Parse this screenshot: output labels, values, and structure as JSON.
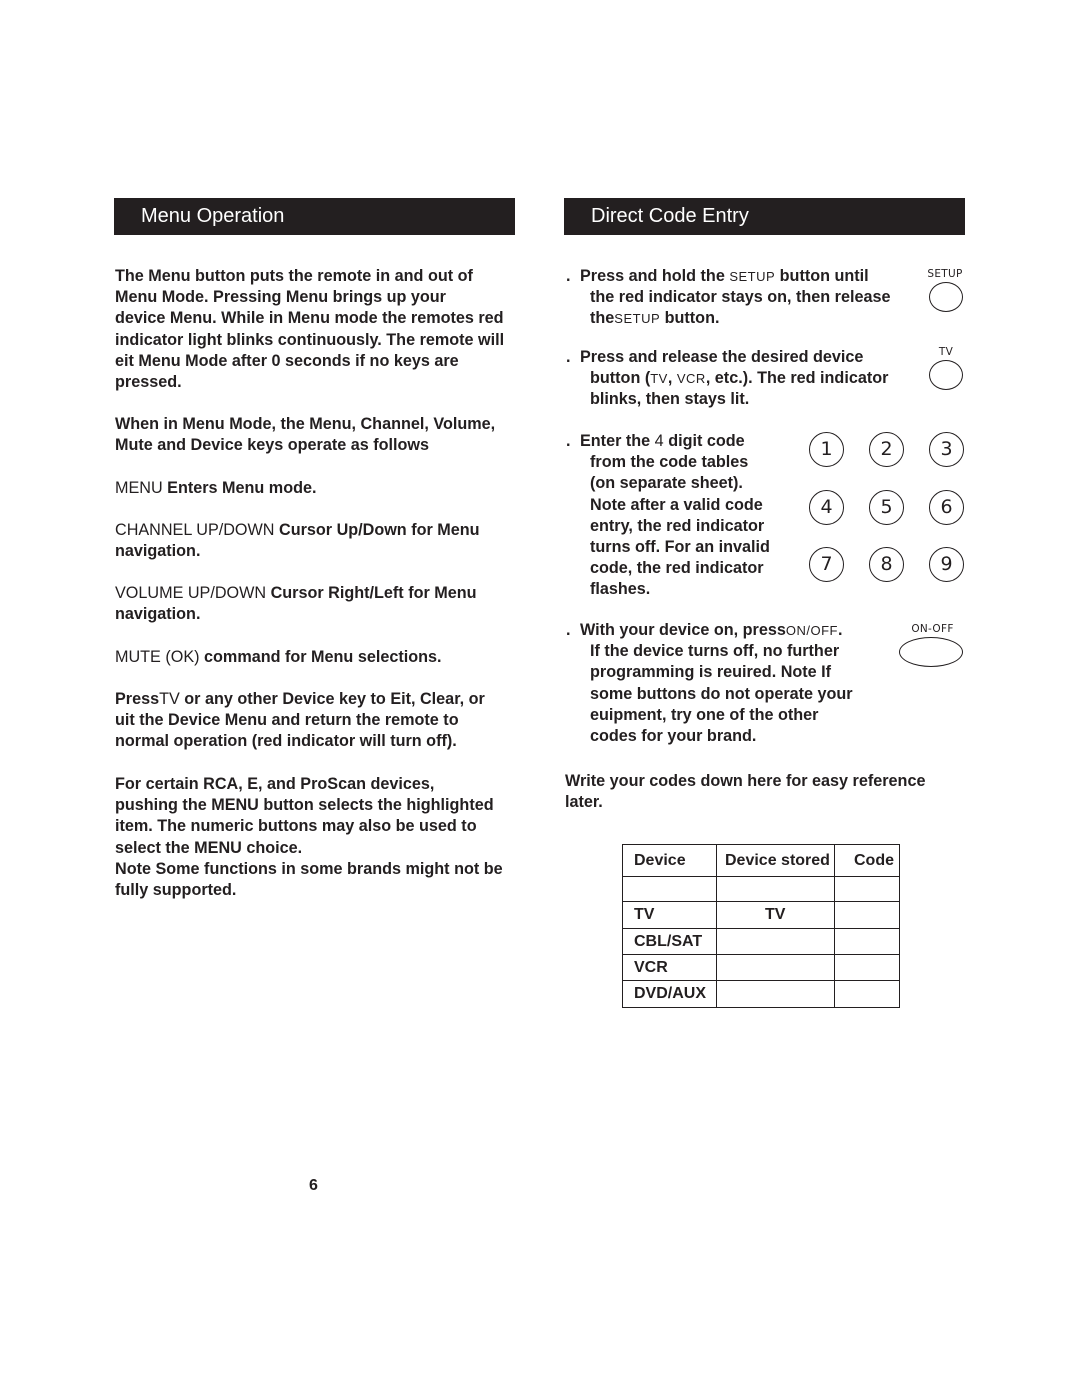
{
  "menu_operation": {
    "title": "Menu Operation",
    "intro_lines": [
      "The Menu button puts the remote in and out of",
      "Menu Mode. Pressing Menu brings up your",
      "device Menu. While in Menu mode the remotes red",
      "indicator light blinks continuously. The remote will",
      "eit Menu Mode after 0 seconds if no keys are",
      "pressed."
    ],
    "keys_intro_lines": [
      "When in Menu Mode, the Menu, Channel, Volume,",
      "Mute and Device keys operate as follows"
    ],
    "menu_key": {
      "key": "MENU",
      "desc": "Enters Menu mode."
    },
    "channel_key": {
      "key": "CHANNEL UP/DOWN",
      "desc": "Cursor Up/Down for Menu",
      "desc2": "navigation."
    },
    "volume_key": {
      "key": "VOLUME UP/DOWN",
      "desc": "Cursor Right/Left for Menu",
      "desc2": "navigation."
    },
    "mute_key": {
      "key": "MUTE (OK)",
      "desc": "command for Menu selections."
    },
    "exit_para": {
      "pre": "Press",
      "key": "TV",
      "line1_rest": "or any other Device key to Eit, Clear, or",
      "line2": "uit the Device Menu and return the remote to",
      "line3": "normal operation (red indicator will turn off)."
    },
    "rca_lines": [
      "For certain RCA, E, and ProScan devices,",
      "pushing the MENU button selects the highlighted",
      "item. The numeric buttons may also be used to",
      "select the MENU choice.",
      "Note Some functions in some brands might not be",
      "fully supported."
    ]
  },
  "direct_code_entry": {
    "title": "Direct Code Entry",
    "step_marker": ".",
    "step1": {
      "l1_pre": "Press and hold the",
      "l1_key": "SETUP",
      "l1_post": "button until",
      "l2": "the red indicator stays on, then release",
      "l3_pre": "the",
      "l3_key": "SETUP",
      "l3_post": "button.",
      "button_label": "SETUP"
    },
    "step2": {
      "l1": "Press and release the desired device",
      "l2_pre": "button (",
      "l2_key1": "TV",
      "l2_sep": ", ",
      "l2_key2": "VCR",
      "l2_post": ", etc.). The red indicator",
      "l3": "blinks, then stays lit.",
      "button_label": "TV"
    },
    "step3": {
      "l1_pre": "Enter the",
      "l1_num": "4",
      "l1_post": "digit code",
      "lines": [
        "from the code tables",
        "(on separate sheet).",
        "Note after a valid code",
        "entry, the red indicator",
        "turns off.  For an invalid",
        "code, the red indicator",
        "flashes."
      ],
      "keypad": [
        "1",
        "2",
        "3",
        "4",
        "5",
        "6",
        "7",
        "8",
        "9"
      ]
    },
    "step4": {
      "l1_pre": "With your device on, press",
      "l1_key": "ON/OFF",
      "l1_post": ".",
      "lines": [
        "If the device turns off, no further",
        "programming is reuired. Note If",
        "some buttons do not operate your",
        "euipment, try one of the other",
        "codes for your brand."
      ],
      "button_label": "ON-OFF"
    },
    "write_codes_lines": [
      "Write your codes down here for easy reference",
      "later."
    ],
    "codes_table": {
      "headers": [
        "Device",
        "Device stored",
        "Code"
      ],
      "rows": [
        [
          "",
          "",
          ""
        ],
        [
          "TV",
          "TV",
          ""
        ],
        [
          "CBL/SAT",
          "",
          ""
        ],
        [
          "VCR",
          "",
          ""
        ],
        [
          "DVD/AUX",
          "",
          ""
        ]
      ]
    }
  },
  "page_number": "6"
}
